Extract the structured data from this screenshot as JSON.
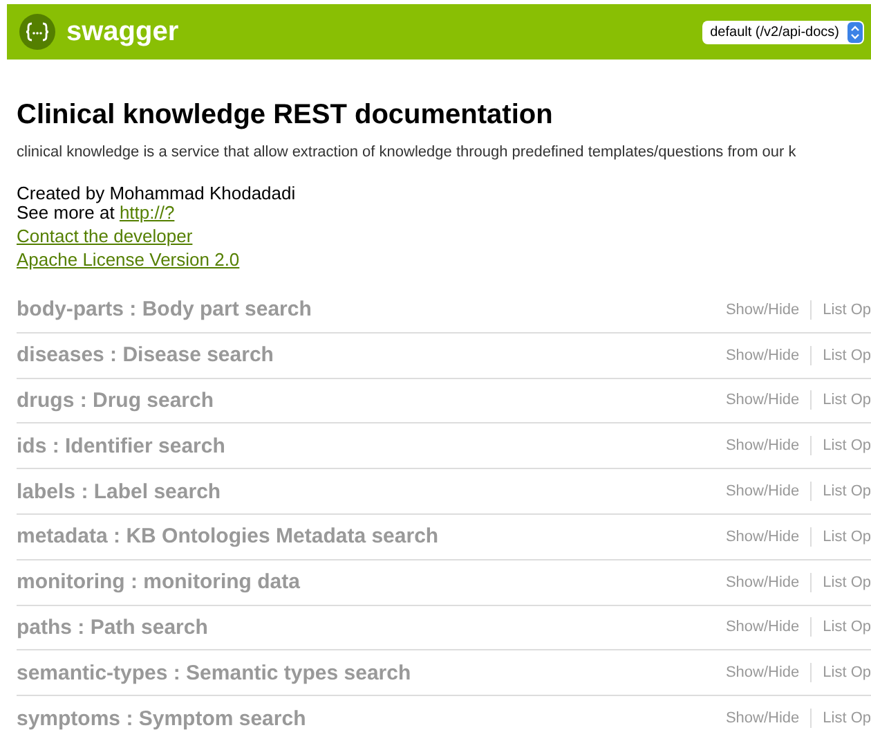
{
  "header": {
    "logo_text": "swagger",
    "api_selector": {
      "value": "default (/v2/api-docs)"
    }
  },
  "info": {
    "title": "Clinical knowledge REST documentation",
    "description": "clinical knowledge is a service that allow extraction of knowledge through predefined templates/questions from our k",
    "created_by": "Created by Mohammad Khodadadi",
    "see_more_label": "See more at",
    "see_more_link": "http://?",
    "contact_link": "Contact the developer",
    "license_link": "Apache License Version 2.0"
  },
  "resources": [
    {
      "name": "body-parts : Body part search",
      "show_hide": "Show/Hide",
      "list_ops": "List Op"
    },
    {
      "name": "diseases : Disease search",
      "show_hide": "Show/Hide",
      "list_ops": "List Op"
    },
    {
      "name": "drugs : Drug search",
      "show_hide": "Show/Hide",
      "list_ops": "List Op"
    },
    {
      "name": "ids : Identifier search",
      "show_hide": "Show/Hide",
      "list_ops": "List Op"
    },
    {
      "name": "labels : Label search",
      "show_hide": "Show/Hide",
      "list_ops": "List Op"
    },
    {
      "name": "metadata : KB Ontologies Metadata search",
      "show_hide": "Show/Hide",
      "list_ops": "List Op"
    },
    {
      "name": "monitoring : monitoring data",
      "show_hide": "Show/Hide",
      "list_ops": "List Op"
    },
    {
      "name": "paths : Path search",
      "show_hide": "Show/Hide",
      "list_ops": "List Op"
    },
    {
      "name": "semantic-types : Semantic types search",
      "show_hide": "Show/Hide",
      "list_ops": "List Op"
    },
    {
      "name": "symptoms : Symptom search",
      "show_hide": "Show/Hide",
      "list_ops": "List Op"
    }
  ]
}
